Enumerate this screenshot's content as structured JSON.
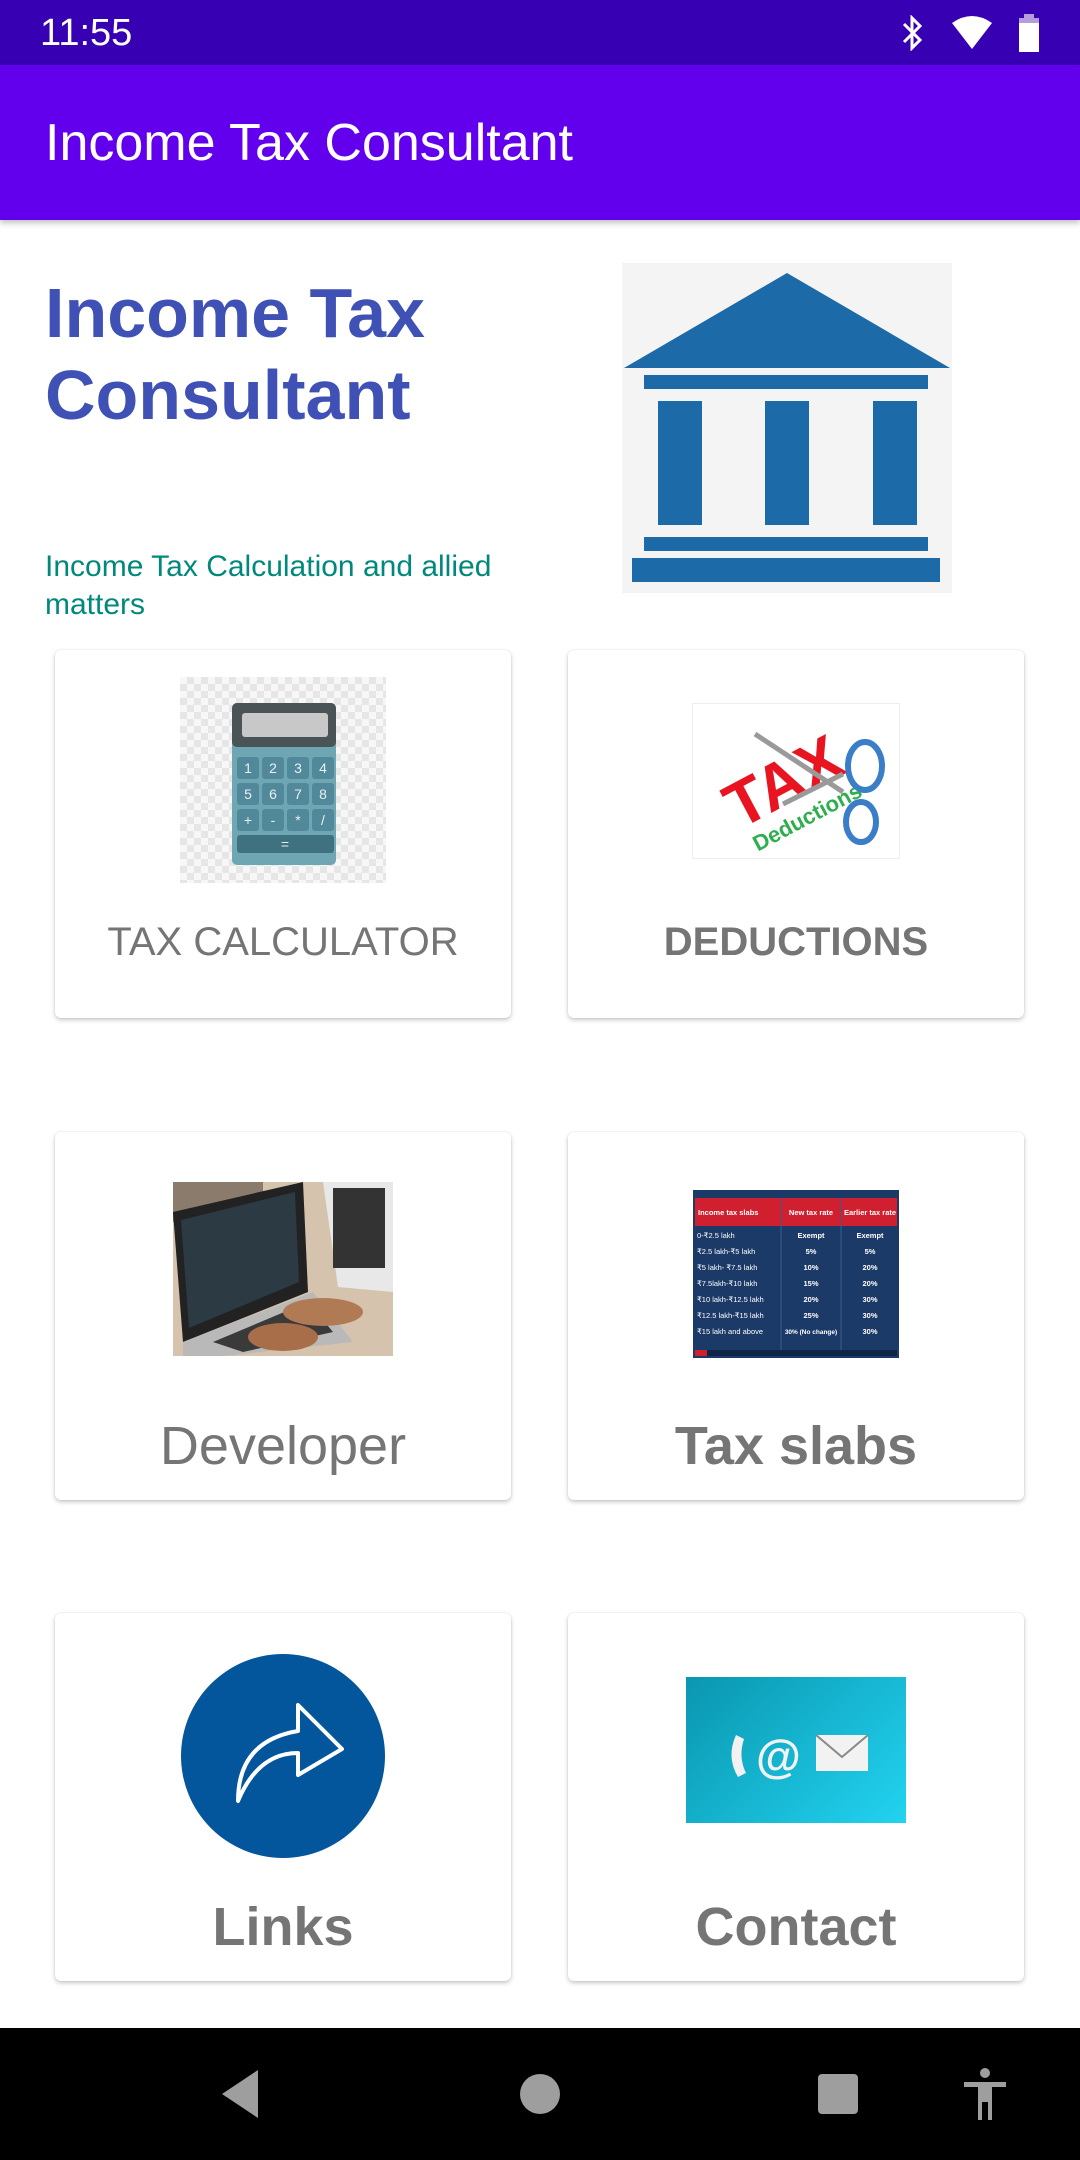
{
  "status_bar": {
    "time": "11:55",
    "icons": [
      "bluetooth-icon",
      "wifi-icon",
      "battery-icon"
    ]
  },
  "app_bar": {
    "title": "Income Tax Consultant"
  },
  "hero": {
    "title": "Income Tax Consultant",
    "subtitle": "Income Tax Calculation and allied matters",
    "logo": "bank-building-icon"
  },
  "cards": [
    {
      "label": "TAX CALCULATOR",
      "image": "calculator-image"
    },
    {
      "label": "DEDUCTIONS",
      "image": "tax-deductions-scissors-image"
    },
    {
      "label": "Developer",
      "image": "developer-laptop-image"
    },
    {
      "label": "Tax slabs",
      "image": "tax-slabs-table-image"
    },
    {
      "label": "Links",
      "image": "share-arrow-icon"
    },
    {
      "label": "Contact",
      "image": "contact-phone-email-image"
    }
  ],
  "calculator_keys": [
    "1",
    "2",
    "3",
    "4",
    "5",
    "6",
    "7",
    "8",
    "+",
    "-",
    "*",
    "/",
    "="
  ],
  "tax_slabs_table": {
    "headers": [
      "Income tax slabs",
      "New tax rate",
      "Earlier tax rate"
    ],
    "rows": [
      [
        "0-₹2.5 lakh",
        "Exempt",
        "Exempt"
      ],
      [
        "₹2.5 lakh-₹5 lakh",
        "5%",
        "5%"
      ],
      [
        "₹5 lakh- ₹7.5 lakh",
        "10%",
        "20%"
      ],
      [
        "₹7.5lakh-₹10 lakh",
        "15%",
        "20%"
      ],
      [
        "₹10 lakh-₹12.5 lakh",
        "20%",
        "30%"
      ],
      [
        "₹12.5 lakh-₹15 lakh",
        "25%",
        "30%"
      ],
      [
        "₹15 lakh and above",
        "30% (No change)",
        "30%"
      ]
    ]
  },
  "deductions_image_text": {
    "main": "TAX",
    "sub": "Deductions"
  },
  "nav_bar": {
    "buttons": [
      "back",
      "home",
      "recents",
      "accessibility"
    ]
  },
  "colors": {
    "status_bar": "#3700b3",
    "app_bar": "#6200ee",
    "hero_title": "#3f51b5",
    "subtitle": "#00897b",
    "label": "#757575",
    "bank_blue": "#1c6aa8"
  }
}
